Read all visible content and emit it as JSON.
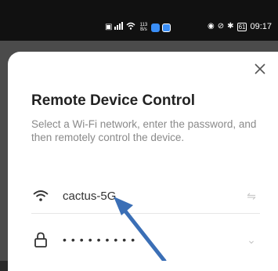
{
  "status_bar": {
    "left_icons": [
      "hd-icon",
      "signal-icon",
      "wifi-icon"
    ],
    "net_speed_value": "113",
    "net_speed_unit": "B/s",
    "app_icon_colors": [
      "#3a8ef6",
      "#3a8ef6"
    ],
    "right_icons": [
      "eye-icon",
      "no-disturb-icon",
      "bluetooth-icon"
    ],
    "battery": "61",
    "time": "09:17"
  },
  "dialog": {
    "title": "Remote Device Control",
    "subtitle": "Select a Wi-Fi network, enter the password, and then remotely control the device.",
    "wifi_field": {
      "value": "cactus-5G",
      "icon": "wifi-icon",
      "action_icon": "swap-icon"
    },
    "password_field": {
      "value": "•••••••••",
      "icon": "lock-icon",
      "action_icon": "chevron-down-icon"
    },
    "close_icon": "close-icon"
  },
  "annotation": {
    "arrow_color": "#3b6fb6"
  }
}
